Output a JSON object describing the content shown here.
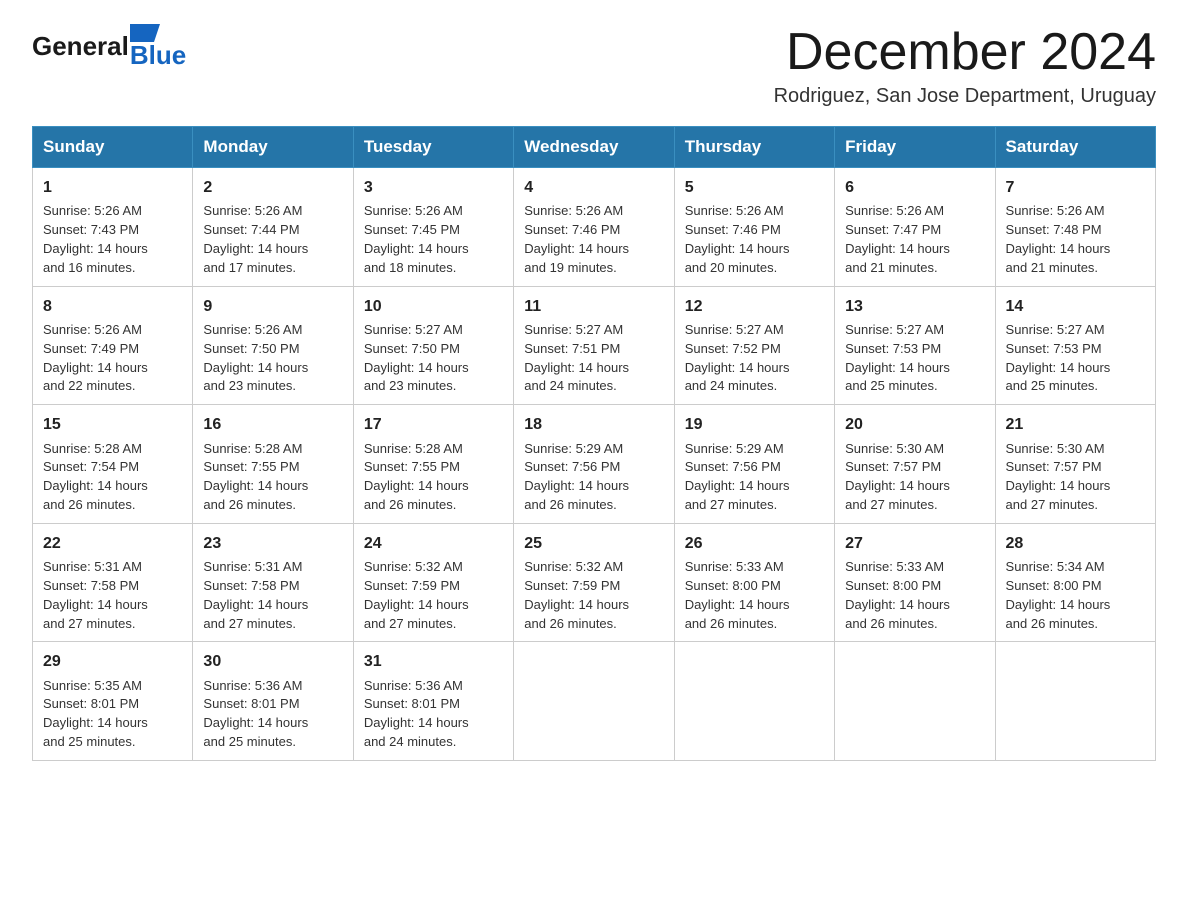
{
  "header": {
    "logo_general": "General",
    "logo_blue": "Blue",
    "month_title": "December 2024",
    "location": "Rodriguez, San Jose Department, Uruguay"
  },
  "days_of_week": [
    "Sunday",
    "Monday",
    "Tuesday",
    "Wednesday",
    "Thursday",
    "Friday",
    "Saturday"
  ],
  "weeks": [
    [
      {
        "day": "1",
        "sunrise": "5:26 AM",
        "sunset": "7:43 PM",
        "daylight": "14 hours and 16 minutes."
      },
      {
        "day": "2",
        "sunrise": "5:26 AM",
        "sunset": "7:44 PM",
        "daylight": "14 hours and 17 minutes."
      },
      {
        "day": "3",
        "sunrise": "5:26 AM",
        "sunset": "7:45 PM",
        "daylight": "14 hours and 18 minutes."
      },
      {
        "day": "4",
        "sunrise": "5:26 AM",
        "sunset": "7:46 PM",
        "daylight": "14 hours and 19 minutes."
      },
      {
        "day": "5",
        "sunrise": "5:26 AM",
        "sunset": "7:46 PM",
        "daylight": "14 hours and 20 minutes."
      },
      {
        "day": "6",
        "sunrise": "5:26 AM",
        "sunset": "7:47 PM",
        "daylight": "14 hours and 21 minutes."
      },
      {
        "day": "7",
        "sunrise": "5:26 AM",
        "sunset": "7:48 PM",
        "daylight": "14 hours and 21 minutes."
      }
    ],
    [
      {
        "day": "8",
        "sunrise": "5:26 AM",
        "sunset": "7:49 PM",
        "daylight": "14 hours and 22 minutes."
      },
      {
        "day": "9",
        "sunrise": "5:26 AM",
        "sunset": "7:50 PM",
        "daylight": "14 hours and 23 minutes."
      },
      {
        "day": "10",
        "sunrise": "5:27 AM",
        "sunset": "7:50 PM",
        "daylight": "14 hours and 23 minutes."
      },
      {
        "day": "11",
        "sunrise": "5:27 AM",
        "sunset": "7:51 PM",
        "daylight": "14 hours and 24 minutes."
      },
      {
        "day": "12",
        "sunrise": "5:27 AM",
        "sunset": "7:52 PM",
        "daylight": "14 hours and 24 minutes."
      },
      {
        "day": "13",
        "sunrise": "5:27 AM",
        "sunset": "7:53 PM",
        "daylight": "14 hours and 25 minutes."
      },
      {
        "day": "14",
        "sunrise": "5:27 AM",
        "sunset": "7:53 PM",
        "daylight": "14 hours and 25 minutes."
      }
    ],
    [
      {
        "day": "15",
        "sunrise": "5:28 AM",
        "sunset": "7:54 PM",
        "daylight": "14 hours and 26 minutes."
      },
      {
        "day": "16",
        "sunrise": "5:28 AM",
        "sunset": "7:55 PM",
        "daylight": "14 hours and 26 minutes."
      },
      {
        "day": "17",
        "sunrise": "5:28 AM",
        "sunset": "7:55 PM",
        "daylight": "14 hours and 26 minutes."
      },
      {
        "day": "18",
        "sunrise": "5:29 AM",
        "sunset": "7:56 PM",
        "daylight": "14 hours and 26 minutes."
      },
      {
        "day": "19",
        "sunrise": "5:29 AM",
        "sunset": "7:56 PM",
        "daylight": "14 hours and 27 minutes."
      },
      {
        "day": "20",
        "sunrise": "5:30 AM",
        "sunset": "7:57 PM",
        "daylight": "14 hours and 27 minutes."
      },
      {
        "day": "21",
        "sunrise": "5:30 AM",
        "sunset": "7:57 PM",
        "daylight": "14 hours and 27 minutes."
      }
    ],
    [
      {
        "day": "22",
        "sunrise": "5:31 AM",
        "sunset": "7:58 PM",
        "daylight": "14 hours and 27 minutes."
      },
      {
        "day": "23",
        "sunrise": "5:31 AM",
        "sunset": "7:58 PM",
        "daylight": "14 hours and 27 minutes."
      },
      {
        "day": "24",
        "sunrise": "5:32 AM",
        "sunset": "7:59 PM",
        "daylight": "14 hours and 27 minutes."
      },
      {
        "day": "25",
        "sunrise": "5:32 AM",
        "sunset": "7:59 PM",
        "daylight": "14 hours and 26 minutes."
      },
      {
        "day": "26",
        "sunrise": "5:33 AM",
        "sunset": "8:00 PM",
        "daylight": "14 hours and 26 minutes."
      },
      {
        "day": "27",
        "sunrise": "5:33 AM",
        "sunset": "8:00 PM",
        "daylight": "14 hours and 26 minutes."
      },
      {
        "day": "28",
        "sunrise": "5:34 AM",
        "sunset": "8:00 PM",
        "daylight": "14 hours and 26 minutes."
      }
    ],
    [
      {
        "day": "29",
        "sunrise": "5:35 AM",
        "sunset": "8:01 PM",
        "daylight": "14 hours and 25 minutes."
      },
      {
        "day": "30",
        "sunrise": "5:36 AM",
        "sunset": "8:01 PM",
        "daylight": "14 hours and 25 minutes."
      },
      {
        "day": "31",
        "sunrise": "5:36 AM",
        "sunset": "8:01 PM",
        "daylight": "14 hours and 24 minutes."
      },
      null,
      null,
      null,
      null
    ]
  ],
  "labels": {
    "sunrise": "Sunrise:",
    "sunset": "Sunset:",
    "daylight": "Daylight:"
  }
}
